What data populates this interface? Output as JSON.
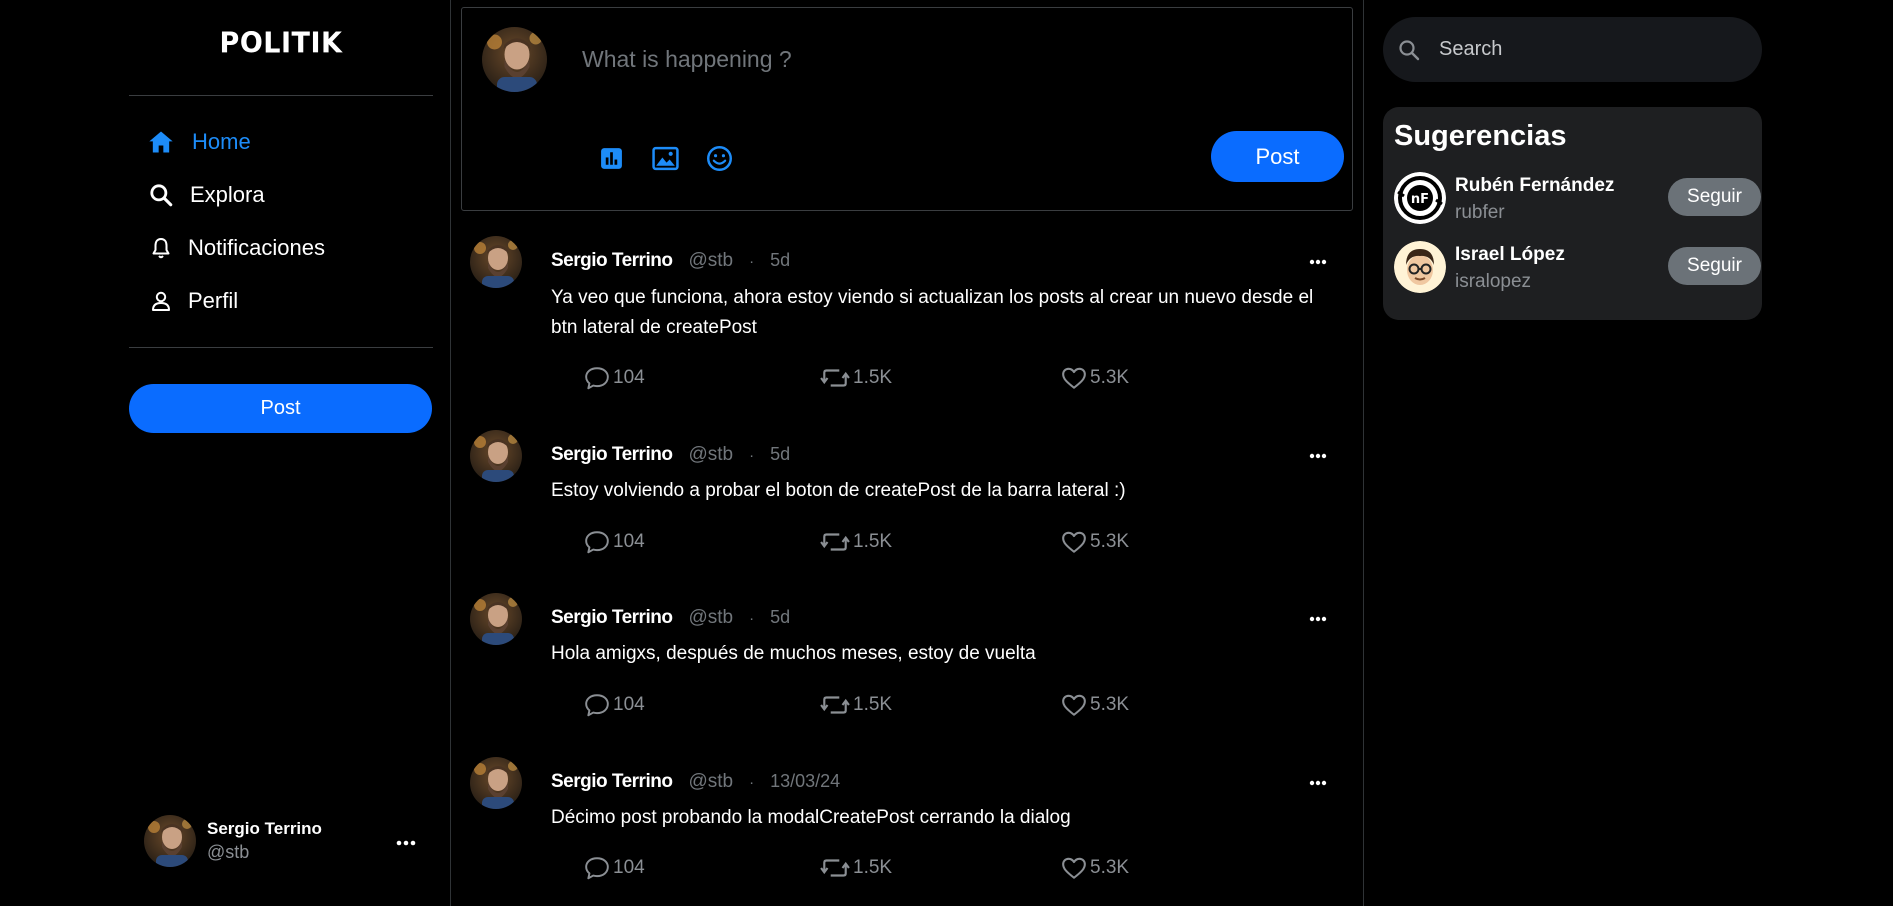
{
  "brand": "POLITIK",
  "nav": [
    {
      "label": "Home",
      "icon": "home-icon",
      "active": true
    },
    {
      "label": "Explora",
      "icon": "search-icon",
      "active": false
    },
    {
      "label": "Notificaciones",
      "icon": "bell-icon",
      "active": false
    },
    {
      "label": "Perfil",
      "icon": "user-icon",
      "active": false
    }
  ],
  "sidebar_post_label": "Post",
  "current_user": {
    "name": "Sergio Terrino",
    "handle": "@stb"
  },
  "composer": {
    "placeholder": "What is happening ?",
    "post_label": "Post"
  },
  "posts": [
    {
      "author": "Sergio Terrino",
      "handle": "@stb",
      "sep": "·",
      "date": "5d",
      "text": "Ya veo que funciona, ahora estoy viendo si actualizan los posts al crear un nuevo desde el btn lateral de createPost",
      "replies": "104",
      "reposts": "1.5K",
      "likes": "5.3K"
    },
    {
      "author": "Sergio Terrino",
      "handle": "@stb",
      "sep": "·",
      "date": "5d",
      "text": "Estoy volviendo a probar el boton de createPost de la barra lateral :)",
      "replies": "104",
      "reposts": "1.5K",
      "likes": "5.3K"
    },
    {
      "author": "Sergio Terrino",
      "handle": "@stb",
      "sep": "·",
      "date": "5d",
      "text": "Hola amigxs, después de muchos meses, estoy de vuelta",
      "replies": "104",
      "reposts": "1.5K",
      "likes": "5.3K"
    },
    {
      "author": "Sergio Terrino",
      "handle": "@stb",
      "sep": "·",
      "date": "13/03/24",
      "text": "Décimo post probando la modalCreatePost cerrando la dialog",
      "replies": "104",
      "reposts": "1.5K",
      "likes": "5.3K"
    }
  ],
  "search": {
    "placeholder": "Search"
  },
  "suggestions": {
    "title": "Sugerencias",
    "follow_label": "Seguir",
    "users": [
      {
        "name": "Rubén Fernández",
        "handle": "rubfer"
      },
      {
        "name": "Israel López",
        "handle": "isralopez"
      }
    ]
  },
  "colors": {
    "accent": "#0a6cff",
    "active_nav": "#1d8cf8",
    "background": "#000000",
    "follow_button": "#6b7278"
  }
}
